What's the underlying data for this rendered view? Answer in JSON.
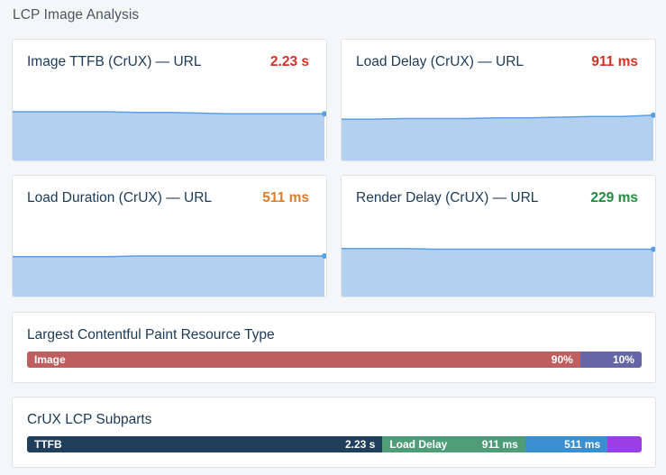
{
  "section": {
    "title": "LCP Image Analysis"
  },
  "colors": {
    "poor": "#d93025",
    "needs_improvement": "#e07b2a",
    "good": "#1e8e3e",
    "spark_fill": "#b4d0f1",
    "spark_line": "#5a9ee6"
  },
  "metrics": [
    {
      "title": "Image TTFB (CrUX) — URL",
      "value": "2.23 s",
      "status": "poor",
      "trend": [
        0.72,
        0.72,
        0.72,
        0.72,
        0.71,
        0.71,
        0.7,
        0.69,
        0.69,
        0.69,
        0.69
      ]
    },
    {
      "title": "Load Delay (CrUX) — URL",
      "value": "911 ms",
      "status": "poor",
      "trend": [
        0.61,
        0.61,
        0.62,
        0.62,
        0.62,
        0.63,
        0.63,
        0.64,
        0.65,
        0.65,
        0.67
      ]
    },
    {
      "title": "Load Duration (CrUX) — URL",
      "value": "511 ms",
      "status": "needs_improvement",
      "trend": [
        0.59,
        0.59,
        0.59,
        0.59,
        0.6,
        0.6,
        0.6,
        0.6,
        0.6,
        0.6,
        0.6
      ]
    },
    {
      "title": "Render Delay (CrUX) — URL",
      "value": "229 ms",
      "status": "good",
      "trend": [
        0.71,
        0.71,
        0.71,
        0.7,
        0.7,
        0.7,
        0.7,
        0.7,
        0.7,
        0.7,
        0.7
      ]
    }
  ],
  "resource_type": {
    "title": "Largest Contentful Paint Resource Type",
    "segments": [
      {
        "label": "Image",
        "value": "90%",
        "share": 0.9,
        "color": "#be5e5e"
      },
      {
        "label": "",
        "value": "10%",
        "share": 0.1,
        "color": "#6466a8"
      }
    ]
  },
  "subparts": {
    "title": "CrUX LCP Subparts",
    "segments": [
      {
        "label": "TTFB",
        "value": "2.23 s",
        "share": 0.5782,
        "color": "#1f3f5c"
      },
      {
        "label": "Load Delay",
        "value": "911 ms",
        "share": 0.2324,
        "color": "#4e9c78"
      },
      {
        "label": "",
        "value": "511 ms",
        "share": 0.1339,
        "color": "#3a8fd0"
      },
      {
        "label": "",
        "value": "",
        "share": 0.0555,
        "color": "#9a3ee6"
      }
    ]
  }
}
